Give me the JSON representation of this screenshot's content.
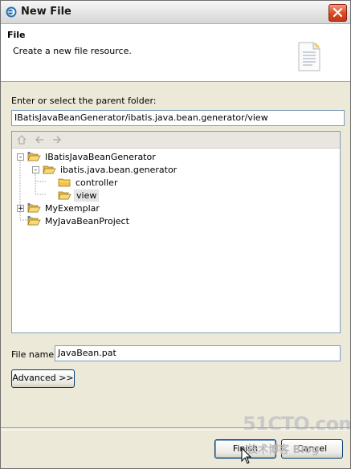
{
  "window": {
    "title": "New File",
    "icon": "eclipse-icon"
  },
  "banner": {
    "title": "File",
    "description": "Create a new file resource.",
    "icon": "file-wizard-icon"
  },
  "parent_folder": {
    "label": "Enter or select the parent folder:",
    "value": "IBatisJavaBeanGenerator/ibatis.java.bean.generator/view"
  },
  "tree": {
    "toolbar": [
      "home-icon",
      "back-arrow-icon",
      "forward-arrow-icon"
    ],
    "nodes": [
      {
        "label": "IBatisJavaBeanGenerator",
        "expander": "-",
        "type": "project"
      },
      {
        "label": "ibatis.java.bean.generator",
        "expander": "-",
        "type": "folder"
      },
      {
        "label": "controller",
        "type": "folder"
      },
      {
        "label": "view",
        "type": "folder",
        "selected": true
      },
      {
        "label": "MyExemplar",
        "expander": "+",
        "type": "project"
      },
      {
        "label": "MyJavaBeanProject",
        "type": "project"
      }
    ]
  },
  "file_name": {
    "label": "File name:",
    "value": "JavaBean.pat"
  },
  "buttons": {
    "advanced": "Advanced >>",
    "finish": "Finish",
    "cancel": "Cancel"
  },
  "watermark": {
    "main": "51CTO.com",
    "sub": "技术博客 Blog"
  },
  "colors": {
    "dialog_bg": "#ece9d8",
    "input_border": "#7f9db9",
    "close_button": "#d9491f",
    "folder": "#f5c342"
  }
}
